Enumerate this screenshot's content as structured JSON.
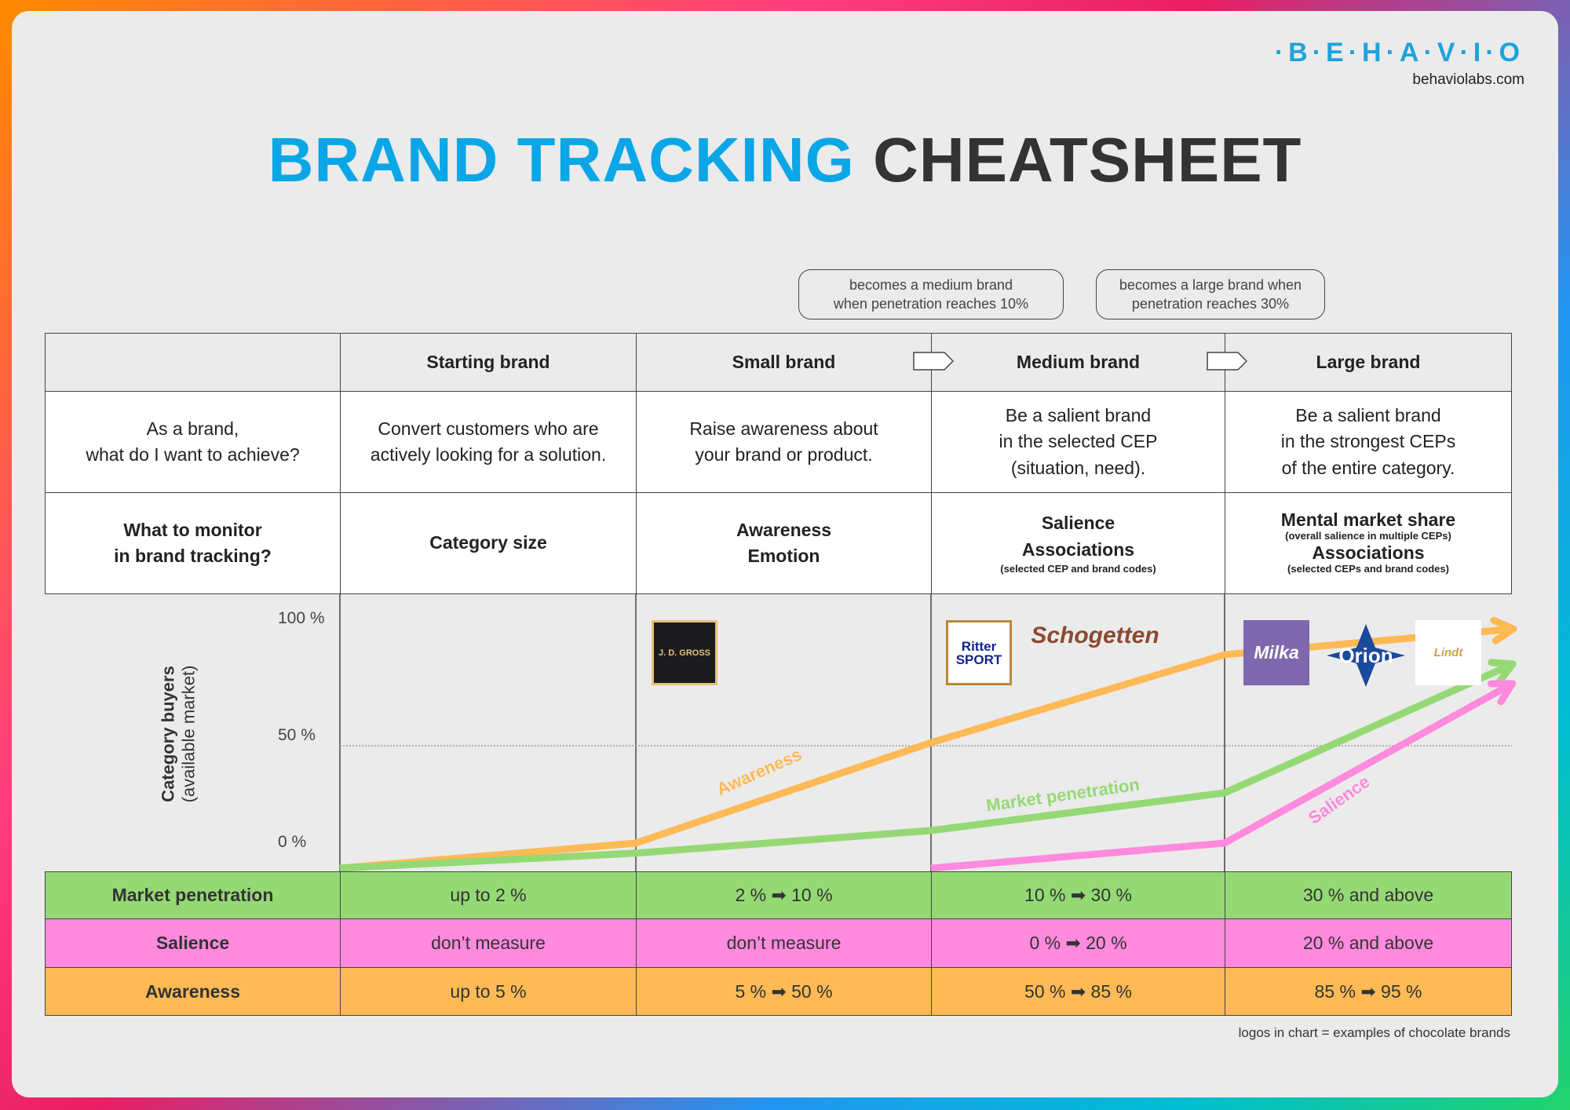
{
  "brand": {
    "logo_text": "·B·E·H·A·V·I·O",
    "url": "behaviolabs.com"
  },
  "title": {
    "part1": "BRAND TRACKING",
    "part2": "CHEATSHEET"
  },
  "notes": [
    {
      "line1": "becomes a medium brand",
      "line2": "when penetration reaches 10%"
    },
    {
      "line1": "becomes a large brand when",
      "line2": "penetration reaches 30%"
    }
  ],
  "table": {
    "columns": [
      "",
      "Starting brand",
      "Small brand",
      "Medium brand",
      "Large brand"
    ],
    "goal_row": {
      "label_line1": "As a brand,",
      "label_line2": "what do I want to achieve?",
      "cells": [
        {
          "l1": "Convert customers who are",
          "l2": "actively looking for a solution.",
          "l3": ""
        },
        {
          "l1": "Raise awareness about",
          "l2": "your brand or product.",
          "l3": ""
        },
        {
          "l1": "Be a salient brand",
          "l2": "in the selected CEP",
          "l3": "(situation, need)."
        },
        {
          "l1": "Be a salient brand",
          "l2": "in the strongest CEPs",
          "l3": "of the entire category."
        }
      ]
    },
    "monitor_row": {
      "label_line1": "What to monitor",
      "label_line2": "in brand tracking?",
      "starting": "Category size",
      "small": {
        "l1": "Awareness",
        "l2": "Emotion"
      },
      "medium": {
        "l1": "Salience",
        "l2": "Associations",
        "note": "(selected CEP and brand codes)"
      },
      "large": {
        "l1": "Mental market share",
        "note1": "(overall salience in multiple CEPs)",
        "l2": "Associations",
        "note2": "(selected CEPs and brand codes)"
      }
    },
    "metrics": [
      {
        "label": "Market penetration",
        "values": [
          "up to 2 %",
          "2 % ➡ 10 %",
          "10 % ➡ 30 %",
          "30 % and above"
        ],
        "color": "#94d974"
      },
      {
        "label": "Salience",
        "values": [
          "don’t measure",
          "don’t measure",
          "0 % ➡ 20 %",
          "20 % and above"
        ],
        "color": "#ff8ade"
      },
      {
        "label": "Awareness",
        "values": [
          "up to 5 %",
          "5 % ➡ 50 %",
          "50 % ➡ 85 %",
          "85 % ➡ 95 %"
        ],
        "color": "#ffba55"
      }
    ]
  },
  "brand_logos": {
    "small": [
      "J. D. GROSS"
    ],
    "medium": [
      "Ritter SPORT",
      "Schogetten"
    ],
    "large": [
      "Milka",
      "Orion",
      "Lindt"
    ]
  },
  "chart_data": {
    "type": "line",
    "ylabel": "Category buyers",
    "ylabel_sub": "(available market)",
    "yticks": [
      "100 %",
      "50 %",
      "0 %"
    ],
    "ylim": [
      0,
      100
    ],
    "grid": "dashed line at 50 %",
    "x": [
      "Starting brand start",
      "Small brand start",
      "Medium brand start",
      "Large brand start",
      "Large brand end"
    ],
    "series": [
      {
        "name": "Awareness",
        "color": "#ffba55",
        "values": [
          0,
          10,
          50,
          85,
          95
        ]
      },
      {
        "name": "Market penetration",
        "color": "#94d974",
        "values": [
          0,
          6,
          15,
          30,
          80
        ]
      },
      {
        "name": "Salience",
        "color": "#ff8ade",
        "values": [
          null,
          null,
          0,
          10,
          72
        ]
      }
    ]
  },
  "footer": "logos in chart = examples of chocolate brands"
}
